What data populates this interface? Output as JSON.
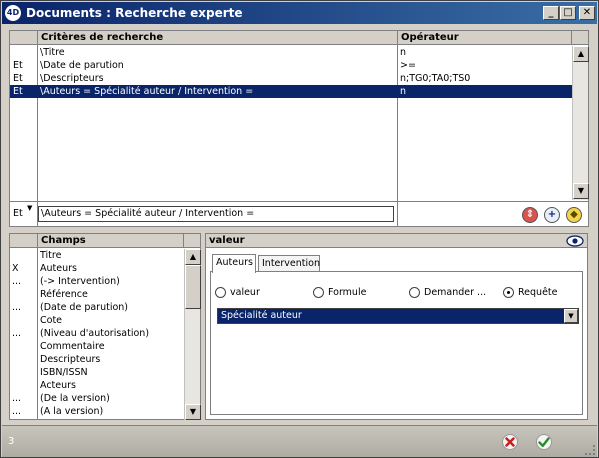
{
  "window": {
    "title": "Documents : Recherche experte",
    "app_logo": "4D"
  },
  "criteria": {
    "headers": {
      "conj": "",
      "criteria": "Critères de recherche",
      "operator": "Opérateur"
    },
    "rows": [
      {
        "conj": "",
        "criteria": "\\Titre",
        "operator": "n"
      },
      {
        "conj": "Et",
        "criteria": "\\Date de parution",
        "operator": ">="
      },
      {
        "conj": "Et",
        "criteria": "\\Descripteurs",
        "operator": "n;TG0;TA0;TS0"
      },
      {
        "conj": "Et",
        "criteria": "\\Auteurs = Spécialité auteur / Intervention =",
        "operator": "n"
      }
    ],
    "selected_row": 3,
    "edit": {
      "conj": "Et",
      "value": "\\Auteurs = Spécialité auteur / Intervention ="
    }
  },
  "fields": {
    "header": "Champs",
    "items": [
      {
        "mark": "",
        "label": "Titre"
      },
      {
        "mark": "X",
        "label": "Auteurs"
      },
      {
        "mark": "...",
        "label": "(-> Intervention)"
      },
      {
        "mark": "",
        "label": "Référence"
      },
      {
        "mark": "...",
        "label": "(Date de parution)"
      },
      {
        "mark": "",
        "label": "Cote"
      },
      {
        "mark": "...",
        "label": "(Niveau d'autorisation)"
      },
      {
        "mark": "",
        "label": "Commentaire"
      },
      {
        "mark": "",
        "label": "Descripteurs"
      },
      {
        "mark": "",
        "label": "ISBN/ISSN"
      },
      {
        "mark": "",
        "label": "Acteurs"
      },
      {
        "mark": "...",
        "label": "(De la version)"
      },
      {
        "mark": "...",
        "label": "(A la version)"
      }
    ]
  },
  "value_panel": {
    "header": "valeur",
    "tabs": [
      "Auteurs",
      "Intervention"
    ],
    "active_tab": 0,
    "radios": [
      {
        "label": "valeur",
        "checked": false
      },
      {
        "label": "Formule",
        "checked": false
      },
      {
        "label": "Demander ...",
        "checked": false
      },
      {
        "label": "Requête",
        "checked": true
      }
    ],
    "combo_value": "Spécialité auteur"
  },
  "status": {
    "count": "3"
  },
  "colors": {
    "selection": "#0a246a",
    "title_start": "#0a246a",
    "title_end": "#3a6ea5"
  }
}
